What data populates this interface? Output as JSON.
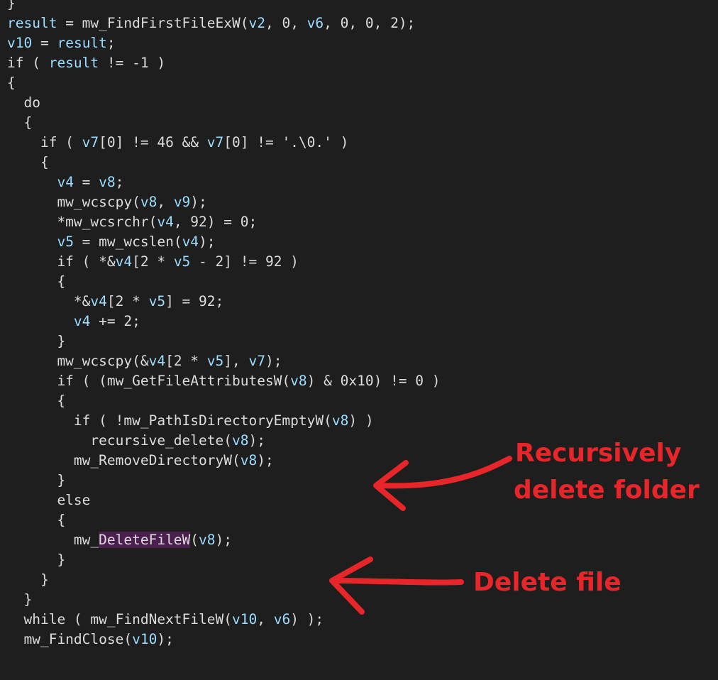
{
  "code_lines": [
    [
      {
        "t": "}",
        "c": "p"
      }
    ],
    [
      {
        "t": "result",
        "c": "v"
      },
      {
        "t": " = mw_FindFirstFileExW(",
        "c": "p"
      },
      {
        "t": "v2",
        "c": "v"
      },
      {
        "t": ", 0, ",
        "c": "p"
      },
      {
        "t": "v6",
        "c": "v"
      },
      {
        "t": ", 0, 0, 2);",
        "c": "p"
      }
    ],
    [
      {
        "t": "v10",
        "c": "v"
      },
      {
        "t": " = ",
        "c": "p"
      },
      {
        "t": "result",
        "c": "v"
      },
      {
        "t": ";",
        "c": "p"
      }
    ],
    [
      {
        "t": "if ( ",
        "c": "p"
      },
      {
        "t": "result",
        "c": "v"
      },
      {
        "t": " != -1 )",
        "c": "p"
      }
    ],
    [
      {
        "t": "{",
        "c": "p"
      }
    ],
    [
      {
        "t": "  do",
        "c": "p"
      }
    ],
    [
      {
        "t": "  {",
        "c": "p"
      }
    ],
    [
      {
        "t": "    if ( ",
        "c": "p"
      },
      {
        "t": "v7",
        "c": "v"
      },
      {
        "t": "[0] != 46 && ",
        "c": "p"
      },
      {
        "t": "v7",
        "c": "v"
      },
      {
        "t": "[0] != '.\\0.' )",
        "c": "p"
      }
    ],
    [
      {
        "t": "    {",
        "c": "p"
      }
    ],
    [
      {
        "t": "      ",
        "c": "p"
      },
      {
        "t": "v4",
        "c": "v"
      },
      {
        "t": " = ",
        "c": "p"
      },
      {
        "t": "v8",
        "c": "v"
      },
      {
        "t": ";",
        "c": "p"
      }
    ],
    [
      {
        "t": "      mw_wcscpy(",
        "c": "p"
      },
      {
        "t": "v8",
        "c": "v"
      },
      {
        "t": ", ",
        "c": "p"
      },
      {
        "t": "v9",
        "c": "v"
      },
      {
        "t": ");",
        "c": "p"
      }
    ],
    [
      {
        "t": "      *mw_wcsrchr(",
        "c": "p"
      },
      {
        "t": "v4",
        "c": "v"
      },
      {
        "t": ", 92) = 0;",
        "c": "p"
      }
    ],
    [
      {
        "t": "      ",
        "c": "p"
      },
      {
        "t": "v5",
        "c": "v"
      },
      {
        "t": " = mw_wcslen(",
        "c": "p"
      },
      {
        "t": "v4",
        "c": "v"
      },
      {
        "t": ");",
        "c": "p"
      }
    ],
    [
      {
        "t": "      if ( *&",
        "c": "p"
      },
      {
        "t": "v4",
        "c": "v"
      },
      {
        "t": "[2 * ",
        "c": "p"
      },
      {
        "t": "v5",
        "c": "v"
      },
      {
        "t": " - 2] != 92 )",
        "c": "p"
      }
    ],
    [
      {
        "t": "      {",
        "c": "p"
      }
    ],
    [
      {
        "t": "        *&",
        "c": "p"
      },
      {
        "t": "v4",
        "c": "v"
      },
      {
        "t": "[2 * ",
        "c": "p"
      },
      {
        "t": "v5",
        "c": "v"
      },
      {
        "t": "] = 92;",
        "c": "p"
      }
    ],
    [
      {
        "t": "        ",
        "c": "p"
      },
      {
        "t": "v4",
        "c": "v"
      },
      {
        "t": " += 2;",
        "c": "p"
      }
    ],
    [
      {
        "t": "      }",
        "c": "p"
      }
    ],
    [
      {
        "t": "      mw_wcscpy(&",
        "c": "p"
      },
      {
        "t": "v4",
        "c": "v"
      },
      {
        "t": "[2 * ",
        "c": "p"
      },
      {
        "t": "v5",
        "c": "v"
      },
      {
        "t": "], ",
        "c": "p"
      },
      {
        "t": "v7",
        "c": "v"
      },
      {
        "t": ");",
        "c": "p"
      }
    ],
    [
      {
        "t": "      if ( (mw_GetFileAttributesW(",
        "c": "p"
      },
      {
        "t": "v8",
        "c": "v"
      },
      {
        "t": ") & 0x10) != 0 )",
        "c": "p"
      }
    ],
    [
      {
        "t": "      {",
        "c": "p"
      }
    ],
    [
      {
        "t": "        if ( !mw_PathIsDirectoryEmptyW(",
        "c": "p"
      },
      {
        "t": "v8",
        "c": "v"
      },
      {
        "t": ") )",
        "c": "p"
      }
    ],
    [
      {
        "t": "          recursive_delete(",
        "c": "p"
      },
      {
        "t": "v8",
        "c": "v"
      },
      {
        "t": ");",
        "c": "p"
      }
    ],
    [
      {
        "t": "        mw_RemoveDirectoryW(",
        "c": "p"
      },
      {
        "t": "v8",
        "c": "v"
      },
      {
        "t": ");",
        "c": "p"
      }
    ],
    [
      {
        "t": "      }",
        "c": "p"
      }
    ],
    [
      {
        "t": "      else",
        "c": "p"
      }
    ],
    [
      {
        "t": "      {",
        "c": "p"
      }
    ],
    [
      {
        "t": "        mw_",
        "c": "p"
      },
      {
        "t": "DeleteFileW",
        "c": "h"
      },
      {
        "t": "(",
        "c": "p"
      },
      {
        "t": "v8",
        "c": "v"
      },
      {
        "t": ");",
        "c": "p"
      }
    ],
    [
      {
        "t": "      }",
        "c": "p"
      }
    ],
    [
      {
        "t": "    }",
        "c": "p"
      }
    ],
    [
      {
        "t": "  }",
        "c": "p"
      }
    ],
    [
      {
        "t": "  while ( mw_FindNextFileW(",
        "c": "p"
      },
      {
        "t": "v10",
        "c": "v"
      },
      {
        "t": ", ",
        "c": "p"
      },
      {
        "t": "v6",
        "c": "v"
      },
      {
        "t": ") );",
        "c": "p"
      }
    ],
    [
      {
        "t": "  mw_FindClose(",
        "c": "p"
      },
      {
        "t": "v10",
        "c": "v"
      },
      {
        "t": ");",
        "c": "p"
      }
    ]
  ],
  "annotations": {
    "recursive_line1": "Recursively",
    "recursive_line2": "delete folder",
    "delete_file": "Delete file"
  },
  "colors": {
    "background": "#1e1e1e",
    "plain_text": "#dcdcdc",
    "variable": "#9cdcfe",
    "highlight_bg": "#4b1f4e",
    "annotation": "#e8262a"
  }
}
